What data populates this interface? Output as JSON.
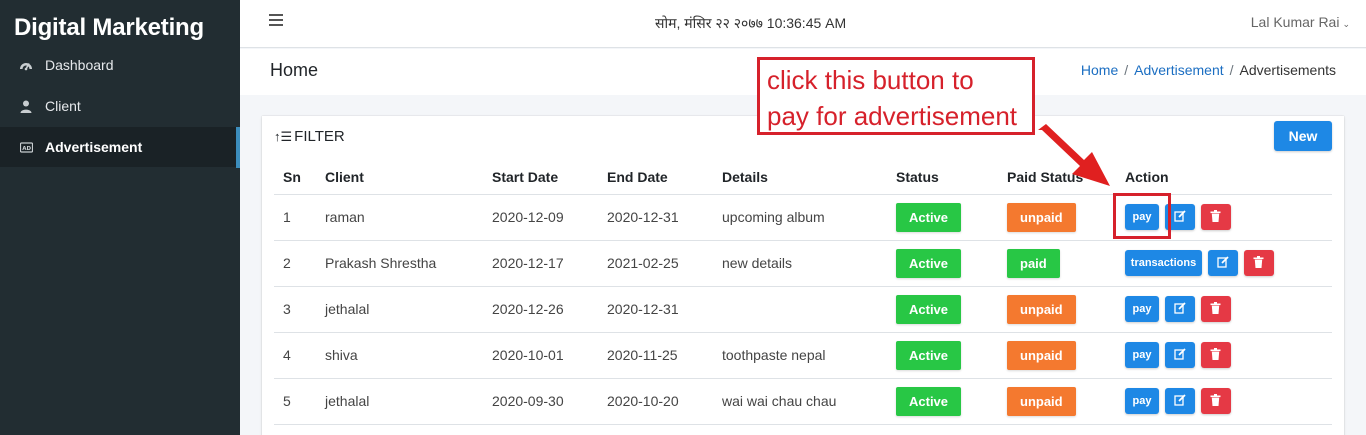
{
  "app": {
    "title": "Digital Marketing"
  },
  "sidebar": {
    "items": [
      {
        "label": "Dashboard",
        "icon": "dashboard-icon",
        "active": false
      },
      {
        "label": "Client",
        "icon": "user-icon",
        "active": false
      },
      {
        "label": "Advertisement",
        "icon": "ad-icon",
        "active": true
      }
    ]
  },
  "topbar": {
    "datetime": "सोम, मंसिर २२ २०७७ 10:36:45 AM",
    "user": "Lal Kumar Rai"
  },
  "header": {
    "title": "Home",
    "breadcrumb": [
      "Home",
      "Advertisement",
      "Advertisements"
    ]
  },
  "card": {
    "filter_label": "FILTER",
    "new_label": "New"
  },
  "table": {
    "columns": [
      "Sn",
      "Client",
      "Start Date",
      "End Date",
      "Details",
      "Status",
      "Paid Status",
      "Action"
    ],
    "rows": [
      {
        "sn": "1",
        "client": "raman",
        "start": "2020-12-09",
        "end": "2020-12-31",
        "details": "upcoming album",
        "status": "Active",
        "paid": "unpaid",
        "action": "pay"
      },
      {
        "sn": "2",
        "client": "Prakash Shrestha",
        "start": "2020-12-17",
        "end": "2021-02-25",
        "details": "new details",
        "status": "Active",
        "paid": "paid",
        "action": "transactions"
      },
      {
        "sn": "3",
        "client": "jethalal",
        "start": "2020-12-26",
        "end": "2020-12-31",
        "details": "",
        "status": "Active",
        "paid": "unpaid",
        "action": "pay"
      },
      {
        "sn": "4",
        "client": "shiva",
        "start": "2020-10-01",
        "end": "2020-11-25",
        "details": "toothpaste nepal",
        "status": "Active",
        "paid": "unpaid",
        "action": "pay"
      },
      {
        "sn": "5",
        "client": "jethalal",
        "start": "2020-09-30",
        "end": "2020-10-20",
        "details": "wai wai chau chau",
        "status": "Active",
        "paid": "unpaid",
        "action": "pay"
      }
    ]
  },
  "annotation": {
    "line1": "click this button to",
    "line2": "pay for advertisement"
  },
  "colors": {
    "sidebar_bg": "#222d32",
    "primary": "#1e88e5",
    "success": "#28c745",
    "warning": "#f4792f",
    "danger": "#e53945",
    "annotation": "#d6212b"
  }
}
